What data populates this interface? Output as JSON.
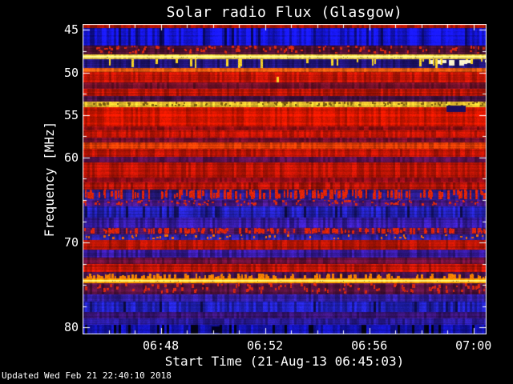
{
  "figure": {
    "background": "#000000",
    "text_color": "#ffffff",
    "footer": "Updated Wed Feb 21 22:40:10 2018"
  },
  "chart_data": {
    "type": "heatmap",
    "title": "Solar radio Flux (Glasgow)",
    "xlabel": "Start Time (21-Aug-13 06:45:03)",
    "ylabel": "Frequency [MHz]",
    "legend": "none",
    "grid": false,
    "x_axis": {
      "range_minutes_after_0645": [
        0,
        15.5
      ],
      "ticks": [
        {
          "label": "06:48",
          "minute": 3
        },
        {
          "label": "06:52",
          "minute": 7
        },
        {
          "label": "06:56",
          "minute": 11
        },
        {
          "label": "07:00",
          "minute": 15
        }
      ],
      "minor_step_minutes": 1
    },
    "y_axis": {
      "range_mhz": [
        44.3,
        80.8
      ],
      "ticks": [
        {
          "label": "45",
          "value": 45
        },
        {
          "label": "50",
          "value": 50
        },
        {
          "label": "55",
          "value": 55
        },
        {
          "label": "60",
          "value": 60
        },
        {
          "label": "70",
          "value": 70
        },
        {
          "label": "80",
          "value": 80
        }
      ],
      "minor_step_mhz": 2.5
    },
    "palette": {
      "low": "#1414d2",
      "mid": "#c01505",
      "high": "#ffd84a",
      "saturated": "#fff6d0"
    },
    "bands": [
      {
        "a": 0.0,
        "b": 0.013,
        "c": "#a81200",
        "n": 0.25
      },
      {
        "a": 0.013,
        "b": 0.07,
        "c": "#1414d2",
        "n": 0.3,
        "s": "dark-streak"
      },
      {
        "a": 0.07,
        "b": 0.098,
        "c": "#4c1030",
        "n": 0.3,
        "s": "red-speck"
      },
      {
        "a": 0.098,
        "b": 0.113,
        "c": "#ffd84a",
        "n": 0.14,
        "s": "bright-line"
      },
      {
        "a": 0.113,
        "b": 0.143,
        "c": "#221580",
        "n": 0.3,
        "s": "yellow-dash"
      },
      {
        "a": 0.143,
        "b": 0.155,
        "c": "#e55a10",
        "n": 0.2
      },
      {
        "a": 0.155,
        "b": 0.188,
        "c": "#c01505",
        "n": 0.22
      },
      {
        "a": 0.188,
        "b": 0.209,
        "c": "#6e1028",
        "n": 0.25
      },
      {
        "a": 0.209,
        "b": 0.232,
        "c": "#b51405",
        "n": 0.22
      },
      {
        "a": 0.232,
        "b": 0.25,
        "c": "#451245",
        "n": 0.28
      },
      {
        "a": 0.25,
        "b": 0.267,
        "c": "#d8b22a",
        "n": 0.2,
        "s": "dark-dot"
      },
      {
        "a": 0.267,
        "b": 0.33,
        "c": "#d41600",
        "n": 0.2
      },
      {
        "a": 0.33,
        "b": 0.343,
        "c": "#8e0e12",
        "n": 0.25
      },
      {
        "a": 0.343,
        "b": 0.366,
        "c": "#c21505",
        "n": 0.22
      },
      {
        "a": 0.366,
        "b": 0.381,
        "c": "#6e0e2a",
        "n": 0.26
      },
      {
        "a": 0.381,
        "b": 0.402,
        "c": "#e03c05",
        "n": 0.22
      },
      {
        "a": 0.402,
        "b": 0.428,
        "c": "#c01505",
        "n": 0.22
      },
      {
        "a": 0.428,
        "b": 0.446,
        "c": "#54104a",
        "n": 0.28
      },
      {
        "a": 0.446,
        "b": 0.495,
        "c": "#bb1405",
        "n": 0.22
      },
      {
        "a": 0.495,
        "b": 0.51,
        "c": "#8a0c18",
        "n": 0.25
      },
      {
        "a": 0.51,
        "b": 0.534,
        "c": "#b01408",
        "n": 0.28
      },
      {
        "a": 0.534,
        "b": 0.567,
        "c": "#281a85",
        "n": 0.3,
        "s": "red-dash"
      },
      {
        "a": 0.567,
        "b": 0.588,
        "c": "#3f1578",
        "n": 0.28,
        "s": "red-speck"
      },
      {
        "a": 0.588,
        "b": 0.624,
        "c": "#2220b5",
        "n": 0.3,
        "s": "dark-streak"
      },
      {
        "a": 0.624,
        "b": 0.657,
        "c": "#321a9e",
        "n": 0.3
      },
      {
        "a": 0.657,
        "b": 0.678,
        "c": "#4c1560",
        "n": 0.28,
        "s": "red-dash"
      },
      {
        "a": 0.678,
        "b": 0.696,
        "c": "#2a1f9e",
        "n": 0.28,
        "s": "orange-speck"
      },
      {
        "a": 0.696,
        "b": 0.727,
        "c": "#b51505",
        "n": 0.22
      },
      {
        "a": 0.727,
        "b": 0.753,
        "c": "#331895",
        "n": 0.3
      },
      {
        "a": 0.753,
        "b": 0.773,
        "c": "#651038",
        "n": 0.26
      },
      {
        "a": 0.773,
        "b": 0.799,
        "c": "#be1505",
        "n": 0.22
      },
      {
        "a": 0.799,
        "b": 0.82,
        "c": "#42124e",
        "n": 0.28,
        "s": "orange-dash"
      },
      {
        "a": 0.82,
        "b": 0.834,
        "c": "#ff9800",
        "n": 0.14,
        "s": "bright-line"
      },
      {
        "a": 0.834,
        "b": 0.871,
        "c": "#55123f",
        "n": 0.3,
        "s": "red-speck"
      },
      {
        "a": 0.871,
        "b": 0.894,
        "c": "#2d1b96",
        "n": 0.3
      },
      {
        "a": 0.894,
        "b": 0.928,
        "c": "#1f1fb2",
        "n": 0.3,
        "s": "dark-streak"
      },
      {
        "a": 0.928,
        "b": 0.948,
        "c": "#3a1478",
        "n": 0.28
      },
      {
        "a": 0.948,
        "b": 0.969,
        "c": "#281a98",
        "n": 0.28
      },
      {
        "a": 0.969,
        "b": 1.0,
        "c": "#1111a8",
        "n": 0.3,
        "s": "black-streak"
      }
    ],
    "specks": [
      {
        "x": 0.48,
        "y": 0.17,
        "w": 3,
        "h": 7,
        "c": "#ffd828"
      },
      {
        "x": 0.9,
        "y": 0.262,
        "w": 24,
        "h": 8,
        "c": "#1a0d60"
      },
      {
        "x": 0.32,
        "y": 0.975,
        "w": 10,
        "h": 8,
        "c": "#00001e"
      }
    ]
  }
}
